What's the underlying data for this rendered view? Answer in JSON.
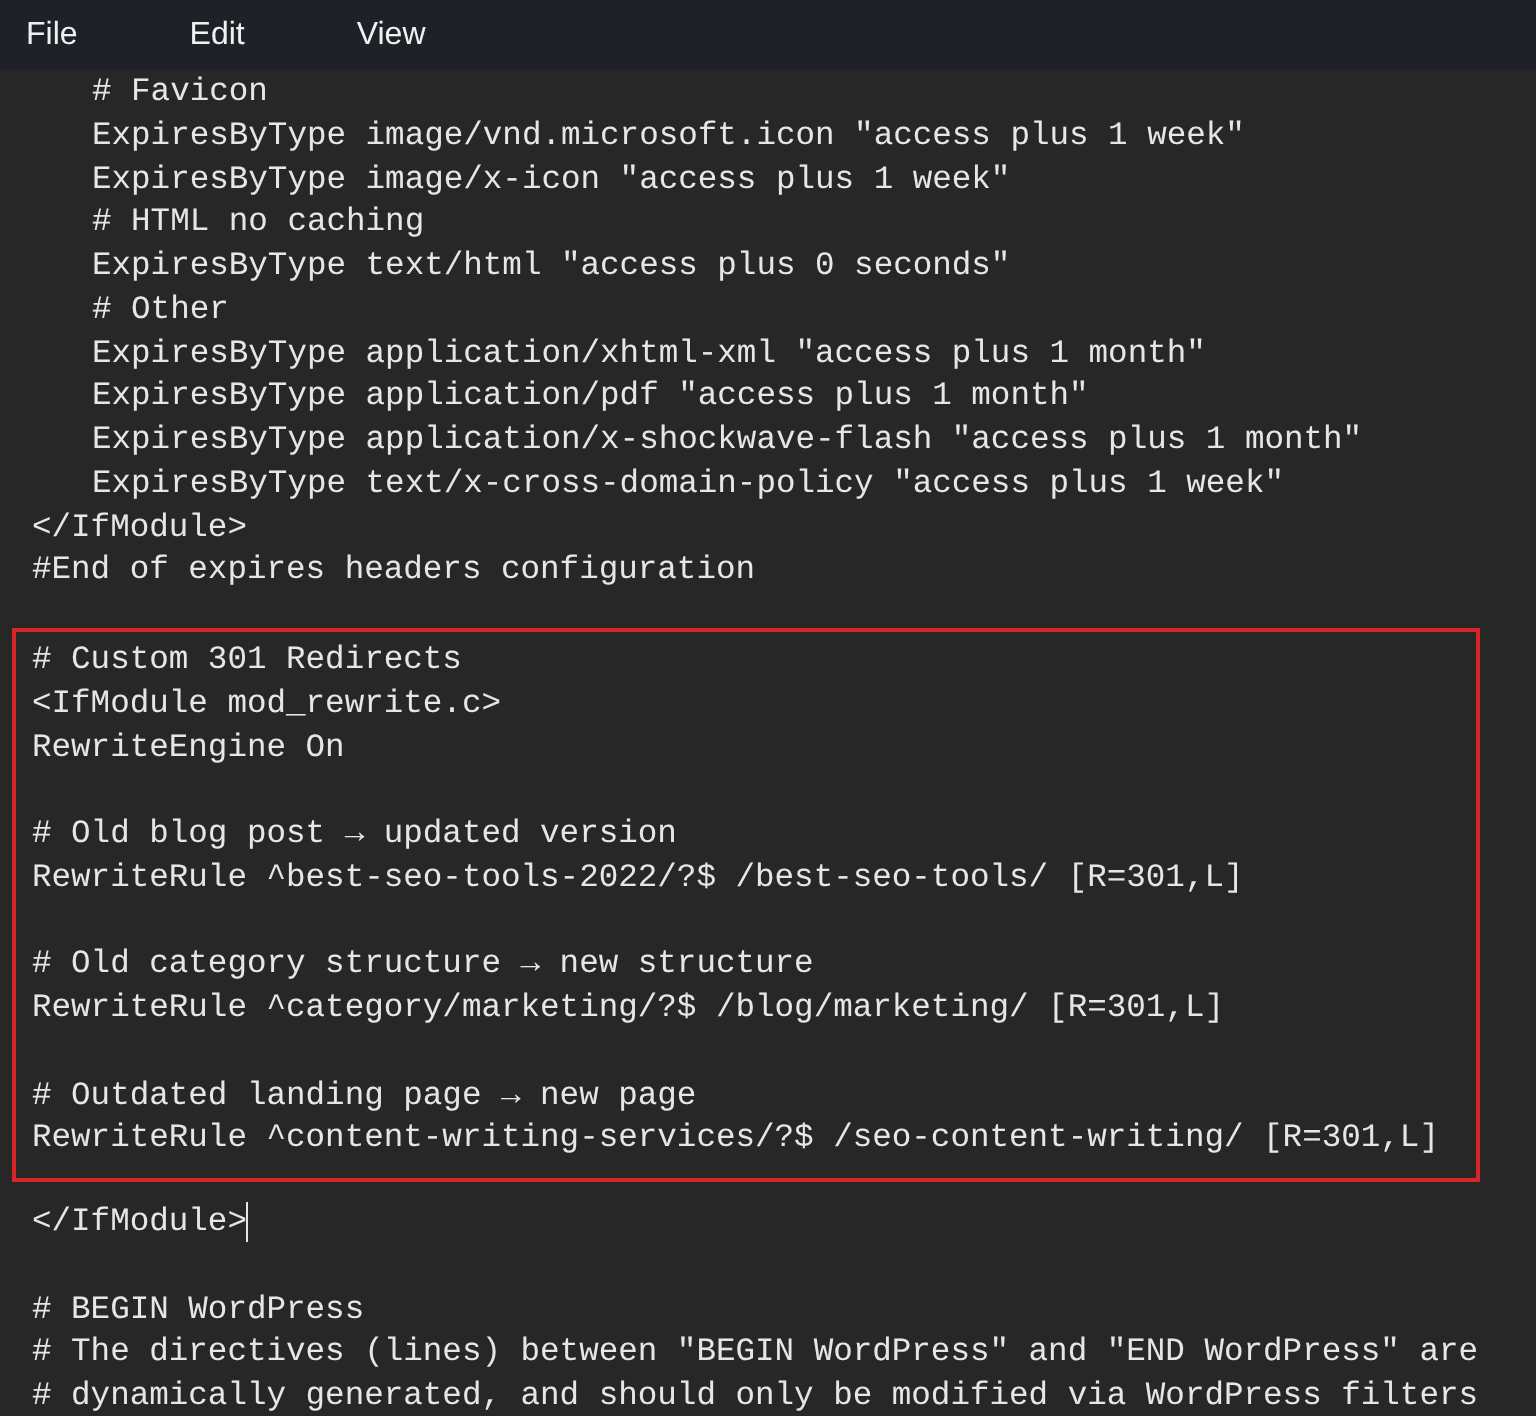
{
  "menu": [
    "File",
    "Edit",
    "View"
  ],
  "lines_before": [
    {
      "kind": "code",
      "indented": true,
      "text": "# Favicon"
    },
    {
      "kind": "code",
      "indented": true,
      "text": "ExpiresByType image/vnd.microsoft.icon \"access plus 1 week\""
    },
    {
      "kind": "code",
      "indented": true,
      "text": "ExpiresByType image/x-icon \"access plus 1 week\""
    },
    {
      "kind": "code",
      "indented": true,
      "text": "# HTML no caching"
    },
    {
      "kind": "code",
      "indented": true,
      "text": "ExpiresByType text/html \"access plus 0 seconds\""
    },
    {
      "kind": "code",
      "indented": true,
      "text": "# Other"
    },
    {
      "kind": "code",
      "indented": true,
      "text": "ExpiresByType application/xhtml-xml \"access plus 1 month\""
    },
    {
      "kind": "code",
      "indented": true,
      "text": "ExpiresByType application/pdf \"access plus 1 month\""
    },
    {
      "kind": "code",
      "indented": true,
      "text": "ExpiresByType application/x-shockwave-flash \"access plus 1 month\""
    },
    {
      "kind": "code",
      "indented": true,
      "text": "ExpiresByType text/x-cross-domain-policy \"access plus 1 week\""
    },
    {
      "kind": "code",
      "indented": false,
      "text": "</IfModule>"
    },
    {
      "kind": "code",
      "indented": false,
      "text": "#End of expires headers configuration"
    }
  ],
  "highlighted_lines": [
    {
      "kind": "code",
      "indented": false,
      "text": "# Custom 301 Redirects"
    },
    {
      "kind": "code",
      "indented": false,
      "text": "<IfModule mod_rewrite.c>"
    },
    {
      "kind": "code",
      "indented": false,
      "text": "RewriteEngine On"
    },
    {
      "kind": "blank"
    },
    {
      "kind": "code",
      "indented": false,
      "text": "# Old blog post → updated version"
    },
    {
      "kind": "code",
      "indented": false,
      "text": "RewriteRule ^best-seo-tools-2022/?$ /best-seo-tools/ [R=301,L]"
    },
    {
      "kind": "blank"
    },
    {
      "kind": "code",
      "indented": false,
      "text": "# Old category structure → new structure"
    },
    {
      "kind": "code",
      "indented": false,
      "text": "RewriteRule ^category/marketing/?$ /blog/marketing/ [R=301,L]"
    },
    {
      "kind": "blank"
    },
    {
      "kind": "code",
      "indented": false,
      "text": "# Outdated landing page → new page"
    },
    {
      "kind": "code",
      "indented": false,
      "text": "RewriteRule ^content-writing-services/?$ /seo-content-writing/ [R=301,L]"
    }
  ],
  "lines_after": [
    {
      "kind": "code",
      "indented": false,
      "text": "</IfModule>",
      "cursor": true
    },
    {
      "kind": "blank"
    },
    {
      "kind": "code",
      "indented": false,
      "text": "# BEGIN WordPress"
    },
    {
      "kind": "code",
      "indented": false,
      "text": "# The directives (lines) between \"BEGIN WordPress\" and \"END WordPress\" are"
    },
    {
      "kind": "code",
      "indented": false,
      "text": "# dynamically generated, and should only be modified via WordPress filters"
    }
  ]
}
